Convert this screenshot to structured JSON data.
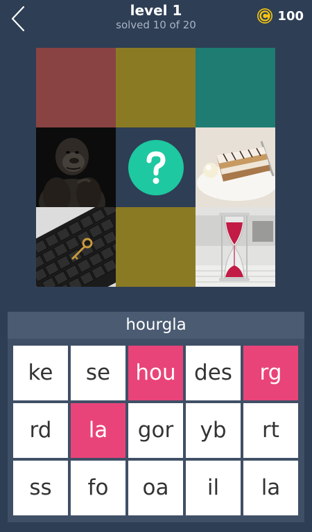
{
  "header": {
    "level_title": "level 1",
    "progress": "solved 10 of 20",
    "coins": "100",
    "back_icon": "chevron-left-icon",
    "coin_icon": "coin-icon"
  },
  "puzzle": {
    "hint_icon": "question-mark-icon",
    "tiles": [
      {
        "kind": "solved",
        "color": "#8a4343"
      },
      {
        "kind": "solved",
        "color": "#8a7a24"
      },
      {
        "kind": "solved",
        "color": "#1e7c72"
      },
      {
        "kind": "image",
        "subject": "gorilla"
      },
      {
        "kind": "hint"
      },
      {
        "kind": "image",
        "subject": "cake"
      },
      {
        "kind": "image",
        "subject": "keyboard with key"
      },
      {
        "kind": "solved",
        "color": "#8a7a24"
      },
      {
        "kind": "image",
        "subject": "hourglass"
      }
    ]
  },
  "answer": {
    "text": "hourgla"
  },
  "letter_tiles": [
    {
      "text": "ke",
      "selected": false
    },
    {
      "text": "se",
      "selected": false
    },
    {
      "text": "hou",
      "selected": true
    },
    {
      "text": "des",
      "selected": false
    },
    {
      "text": "rg",
      "selected": true
    },
    {
      "text": "rd",
      "selected": false
    },
    {
      "text": "la",
      "selected": true
    },
    {
      "text": "gor",
      "selected": false
    },
    {
      "text": "yb",
      "selected": false
    },
    {
      "text": "rt",
      "selected": false
    },
    {
      "text": "ss",
      "selected": false
    },
    {
      "text": "fo",
      "selected": false
    },
    {
      "text": "oa",
      "selected": false
    },
    {
      "text": "il",
      "selected": false
    },
    {
      "text": "la",
      "selected": false
    }
  ],
  "colors": {
    "background": "#2e3e55",
    "selected_tile": "#e94479",
    "hint": "#1ec8a0",
    "coin": "#f2c512"
  }
}
